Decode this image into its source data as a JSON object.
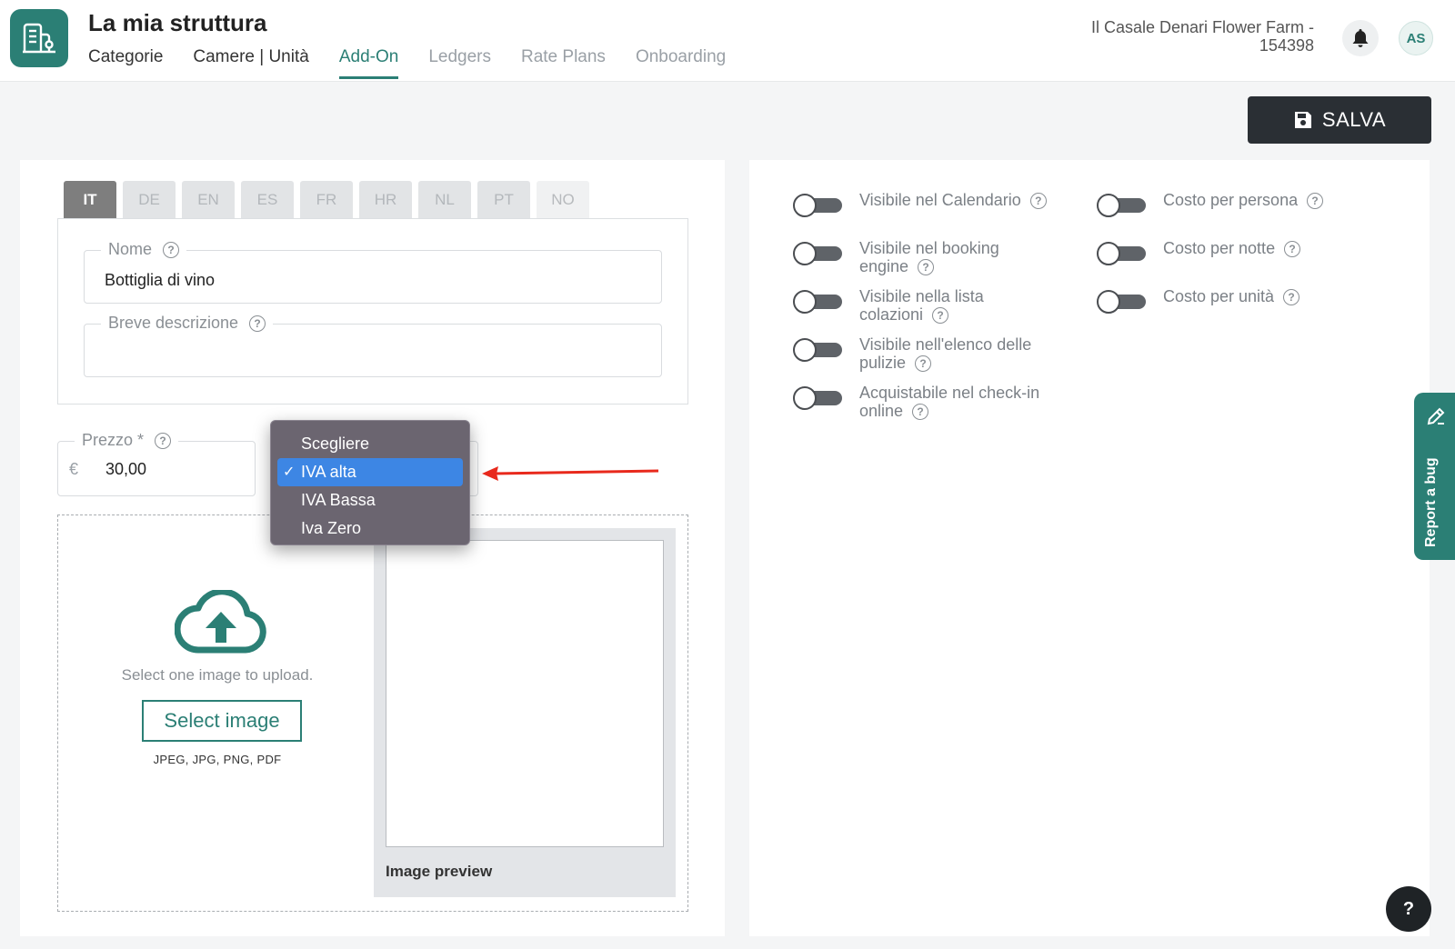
{
  "header": {
    "title": "La mia struttura",
    "tabs": [
      {
        "label": "Categorie"
      },
      {
        "label": "Camere | Unità"
      },
      {
        "label": "Add-On"
      },
      {
        "label": "Ledgers"
      },
      {
        "label": "Rate Plans"
      },
      {
        "label": "Onboarding"
      }
    ],
    "active_tab": "Add-On",
    "property_line1": "Il Casale Denari Flower Farm -",
    "property_line2": "154398",
    "avatar_initials": "AS"
  },
  "toolbar": {
    "save_label": "SALVA"
  },
  "languages": [
    "IT",
    "DE",
    "EN",
    "ES",
    "FR",
    "HR",
    "NL",
    "PT",
    "NO"
  ],
  "active_language": "IT",
  "form": {
    "name_label": "Nome",
    "name_value": "Bottiglia di vino",
    "desc_label": "Breve descrizione",
    "desc_value": "",
    "price_label": "Prezzo *",
    "currency": "€",
    "price_value": "30,00"
  },
  "vat_dropdown": {
    "options": [
      "Scegliere",
      "IVA alta",
      "IVA Bassa",
      "Iva Zero"
    ],
    "selected": "IVA alta",
    "check": "✓"
  },
  "upload": {
    "instruction": "Select one image to upload.",
    "button_label": "Select image",
    "formats": "JPEG, JPG, PNG, PDF",
    "preview_label": "Image preview"
  },
  "toggles_left": [
    {
      "label_line1": "Visibile nel Calendario",
      "label_line2": ""
    },
    {
      "label_line1": "Visibile nel booking",
      "label_line2": "engine"
    },
    {
      "label_line1": "Visibile nella lista",
      "label_line2": "colazioni"
    },
    {
      "label_line1": "Visibile nell'elenco delle",
      "label_line2": "pulizie"
    },
    {
      "label_line1": "Acquistabile nel check-in",
      "label_line2": "online"
    }
  ],
  "toggles_right": [
    {
      "label": "Costo per persona"
    },
    {
      "label": "Costo per notte"
    },
    {
      "label": "Costo per unità"
    }
  ],
  "bug_tab_label": "Report a bug",
  "help_fab": "?",
  "colors": {
    "accent": "#2b7f75",
    "dark": "#2a2f34",
    "dropdown_bg": "#6b6570",
    "dropdown_selected": "#3d86e4",
    "annotation_arrow": "#e8291c"
  }
}
